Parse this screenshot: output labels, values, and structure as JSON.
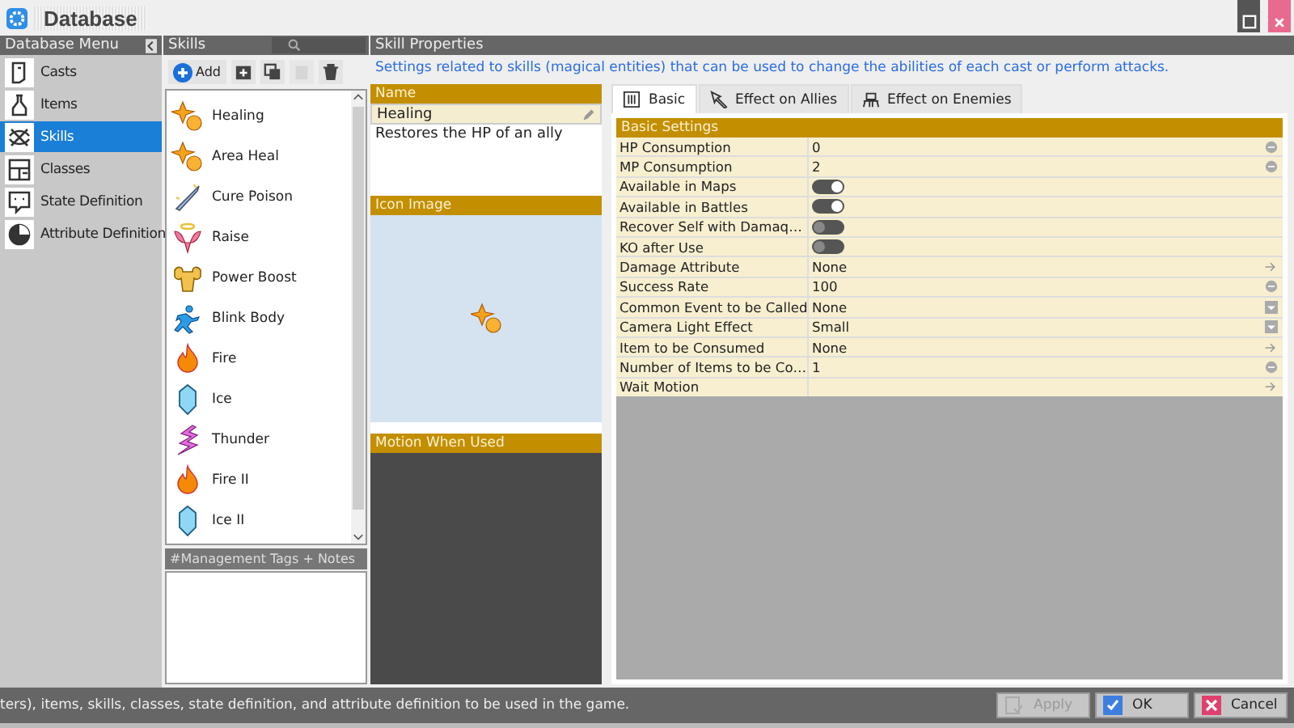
{
  "window": {
    "title": "Database"
  },
  "menu": {
    "title": "Database Menu",
    "items": [
      {
        "label": "Casts",
        "kind": "casts",
        "selected": false
      },
      {
        "label": "Items",
        "kind": "items",
        "selected": false
      },
      {
        "label": "Skills",
        "kind": "skills",
        "selected": true
      },
      {
        "label": "Classes",
        "kind": "classes",
        "selected": false
      },
      {
        "label": "State Definition",
        "kind": "state",
        "selected": false
      },
      {
        "label": "Attribute Definition",
        "kind": "attribute",
        "selected": false
      }
    ]
  },
  "skills": {
    "title": "Skills",
    "add_label": "Add",
    "items": [
      {
        "label": "Healing",
        "kind": "heal",
        "selected": false
      },
      {
        "label": "Area Heal",
        "kind": "heal",
        "selected": false
      },
      {
        "label": "Cure Poison",
        "kind": "sword",
        "selected": false
      },
      {
        "label": "Raise",
        "kind": "angel",
        "selected": false
      },
      {
        "label": "Power Boost",
        "kind": "muscle",
        "selected": false
      },
      {
        "label": "Blink Body",
        "kind": "runner",
        "selected": false
      },
      {
        "label": "Fire",
        "kind": "fire",
        "selected": false
      },
      {
        "label": "Ice",
        "kind": "ice",
        "selected": false
      },
      {
        "label": "Thunder",
        "kind": "thunder",
        "selected": false
      },
      {
        "label": "Fire II",
        "kind": "fire",
        "selected": false
      },
      {
        "label": "Ice II",
        "kind": "ice",
        "selected": false
      }
    ],
    "notes_title": "#Management Tags + Notes"
  },
  "properties": {
    "title": "Skill Properties",
    "description": "Settings related to skills (magical entities) that can be used to change the abilities of each cast or perform attacks.",
    "name_title": "Name",
    "name": "Healing",
    "item_description": "Restores the HP of an ally",
    "icon_title": "Icon Image",
    "motion_title": "Motion When Used",
    "tabs": [
      {
        "label": "Basic",
        "kind": "basic",
        "selected": true
      },
      {
        "label": "Effect on Allies",
        "kind": "allies",
        "selected": false
      },
      {
        "label": "Effect on Enemies",
        "kind": "enemies",
        "selected": false
      }
    ],
    "section": "Basic Settings",
    "rows": [
      {
        "label": "HP Consumption",
        "value": "0",
        "kind": "number"
      },
      {
        "label": "MP Consumption",
        "value": "2",
        "kind": "number"
      },
      {
        "label": "Available in Maps",
        "kind": "toggle",
        "on": true
      },
      {
        "label": "Available in Battles",
        "kind": "toggle",
        "on": true
      },
      {
        "label": "Recover Self with Damaq…",
        "kind": "toggle",
        "on": false
      },
      {
        "label": "KO after Use",
        "kind": "toggle",
        "on": false
      },
      {
        "label": "Damage Attribute",
        "value": "None",
        "kind": "link"
      },
      {
        "label": "Success Rate",
        "value": "100",
        "kind": "number"
      },
      {
        "label": "Common Event to be Called",
        "value": "None",
        "kind": "dropdown"
      },
      {
        "label": "Camera Light Effect",
        "value": "Small",
        "kind": "dropdown"
      },
      {
        "label": "Item to be Consumed",
        "value": "None",
        "kind": "link"
      },
      {
        "label": "Number of Items to be Co…",
        "value": "1",
        "kind": "number"
      },
      {
        "label": "Wait Motion",
        "kind": "link"
      }
    ]
  },
  "status_bar": {
    "text": "ters), items, skills, classes, state definition, and attribute definition to be used in the game.",
    "buttons": [
      {
        "label": "Apply",
        "kind": "apply",
        "disabled": true
      },
      {
        "label": "OK",
        "kind": "ok",
        "disabled": false
      },
      {
        "label": "Cancel",
        "kind": "cancel",
        "disabled": false
      }
    ]
  }
}
